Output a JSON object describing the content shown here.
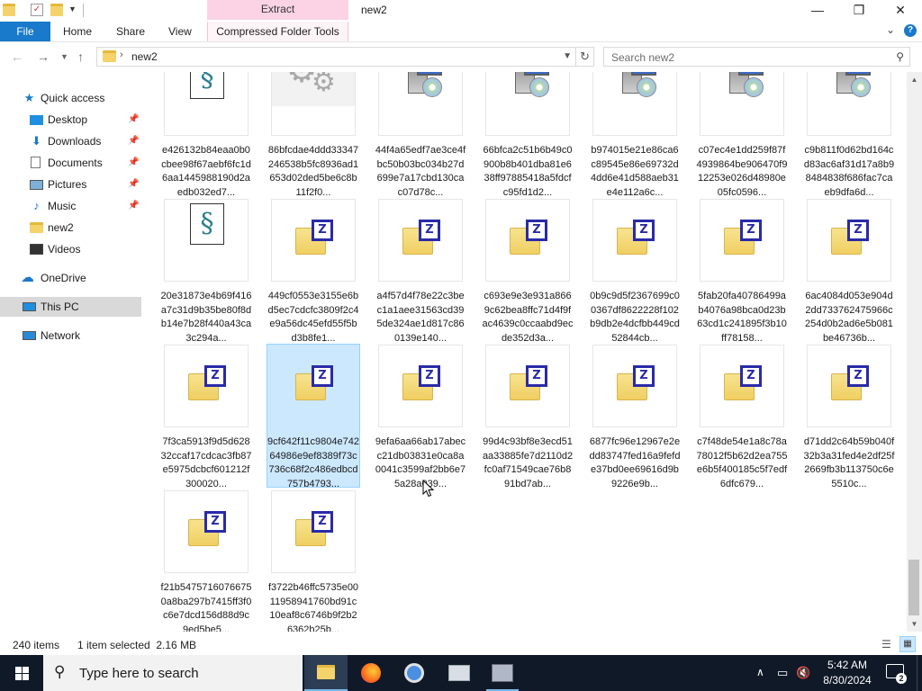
{
  "window": {
    "title": "new2",
    "context_tab_label": "Extract",
    "minimize": "—",
    "maximize": "❐",
    "close": "✕"
  },
  "ribbon": {
    "file": "File",
    "tabs": [
      "Home",
      "Share",
      "View"
    ],
    "context_tab": "Compressed Folder Tools",
    "help": "?"
  },
  "address": {
    "path": "new2",
    "search_placeholder": "Search new2"
  },
  "nav": {
    "quick_access": "Quick access",
    "items": [
      {
        "label": "Desktop",
        "pinned": true
      },
      {
        "label": "Downloads",
        "pinned": true
      },
      {
        "label": "Documents",
        "pinned": true
      },
      {
        "label": "Pictures",
        "pinned": true
      },
      {
        "label": "Music",
        "pinned": true
      },
      {
        "label": "new2",
        "pinned": false
      },
      {
        "label": "Videos",
        "pinned": false
      }
    ],
    "onedrive": "OneDrive",
    "this_pc": "This PC",
    "network": "Network"
  },
  "files": [
    {
      "type": "script",
      "name": "e426132b84eaa0b0cbee98f67aebf6fc1d6aa1445988190d2aedb032ed7..."
    },
    {
      "type": "gear",
      "name": "86bfcdae4ddd33347246538b5fc8936ad1653d02ded5be6c8b11f2f0..."
    },
    {
      "type": "setup",
      "name": "44f4a65edf7ae3ce4fbc50b03bc034b27d699e7a17cbd130cac07d78c..."
    },
    {
      "type": "setup",
      "name": "66bfca2c51b6b49c0900b8b401dba81e638ff97885418a5fdcfc95fd1d2..."
    },
    {
      "type": "setup",
      "name": "b974015e21e86ca6c89545e86e69732d4dd6e41d588aeb31e4e112a6c..."
    },
    {
      "type": "setup",
      "name": "c07ec4e1dd259f87f4939864be906470f912253e026d48980e05fc0596..."
    },
    {
      "type": "setup",
      "name": "c9b811f0d62bd164cd83ac6af31d17a8b98484838f686fac7caeb9dfa6d..."
    },
    {
      "type": "script",
      "name": "20e31873e4b69f416a7c31d9b35be80f8db14e7b28f440a43ca3c294a..."
    },
    {
      "type": "zip",
      "name": "449cf0553e3155e6bd5ec7cdcfc3809f2c4e9a56dc45efd55f5bd3b8fe1..."
    },
    {
      "type": "zip",
      "name": "a4f57d4f78e22c3bec1a1aee31563cd395de324ae1d817c860139e140..."
    },
    {
      "type": "zip",
      "name": "c693e9e3e931a8669c62bea8ffc71d4f9fac4639c0ccaabd9ecde352d3a..."
    },
    {
      "type": "zip",
      "name": "0b9c9d5f2367699c00367df8622228f102b9db2e4dcfbb449cd52844cb..."
    },
    {
      "type": "zip",
      "name": "5fab20fa40786499ab4076a98bca0d23b63cd1c241895f3b10ff78158..."
    },
    {
      "type": "zip",
      "name": "6ac4084d053e904d2dd733762475966c254d0b2ad6e5b081be46736b..."
    },
    {
      "type": "zip",
      "name": "7f3ca5913f9d5d62832ccaf17cdcac3fb87e5975dcbcf601212f300020..."
    },
    {
      "type": "zip",
      "name": "9cf642f11c9804e74264986e9ef8389f73c736c68f2c486edbcd757b4793...",
      "selected": true
    },
    {
      "type": "zip",
      "name": "9efa6aa66ab17abecc21db03831e0ca8a0041c3599af2bb6e75a28a039..."
    },
    {
      "type": "zip",
      "name": "99d4c93bf8e3ecd51aa33885fe7d2110d2fc0af71549cae76b891bd7ab..."
    },
    {
      "type": "zip",
      "name": "6877fc96e12967e2edd83747fed16a9fefde37bd0ee69616d9b9226e9b..."
    },
    {
      "type": "zip",
      "name": "c7f48de54e1a8c78a78012f5b62d2ea755e6b5f400185c5f7edf6dfc679..."
    },
    {
      "type": "zip",
      "name": "d71dd2c64b59b040f32b3a31fed4e2df25f2669fb3b113750c6e5510c..."
    },
    {
      "type": "zip",
      "name": "f21b54757160766750a8ba297b7415ff3f0c6e7dcd156d88d9c9ed5be5..."
    },
    {
      "type": "zip",
      "name": "f3722b46ffc5735e0011958941760bd91c10eaf8c6746b9f2b26362b25b..."
    }
  ],
  "status": {
    "count": "240 items",
    "selection": "1 item selected  2.16 MB"
  },
  "taskbar": {
    "search_placeholder": "Type here to search",
    "time": "5:42 AM",
    "date": "8/30/2024",
    "notifications": "2"
  },
  "icons": {
    "zip_letter": "Z",
    "script_glyph": "§",
    "gear_glyph": "⚙"
  }
}
